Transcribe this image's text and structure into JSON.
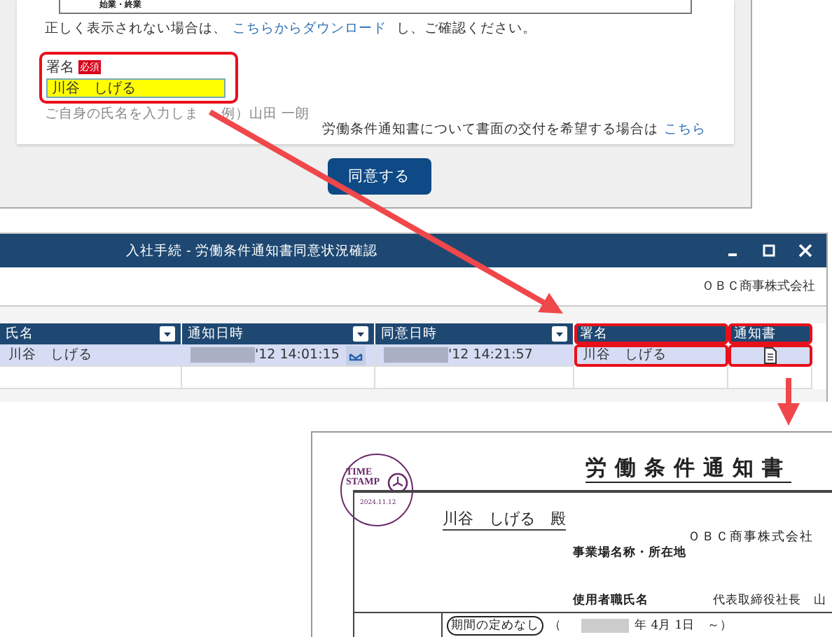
{
  "form_panel": {
    "table_fragment": "始業・終業",
    "download_note": {
      "before": "正しく表示されない場合は、",
      "link": "こちらからダウンロード",
      "after": " し、ご確認ください。"
    },
    "signature": {
      "label": "署名",
      "required_badge": "必須",
      "value": "川谷　しげる",
      "highlighted": true,
      "hint_parts": [
        "ご自身の氏名を入力しま",
        "例）山田 一朗"
      ]
    },
    "paper_request": {
      "text": "労働条件通知書について書面の交付を希望する場合は",
      "link": "こちら"
    },
    "agree_button": "同意する"
  },
  "status_window": {
    "title": "入社手続 - 労働条件通知書同意状況確認",
    "company": "ＯＢＣ商事株式会社",
    "columns": [
      {
        "label": "氏名",
        "filter": true,
        "highlighted": false
      },
      {
        "label": "通知日時",
        "filter": true,
        "highlighted": false
      },
      {
        "label": "同意日時",
        "filter": true,
        "highlighted": false
      },
      {
        "label": "署名",
        "filter": false,
        "highlighted": true
      },
      {
        "label": "通知書",
        "filter": false,
        "highlighted": true
      }
    ],
    "rows": [
      {
        "selected": true,
        "cells": [
          {
            "kind": "text",
            "text": "川谷　しげる"
          },
          {
            "kind": "masked_date",
            "text": "'12 14:01:15",
            "mail_icon": true
          },
          {
            "kind": "masked_date",
            "text": "'12 14:21:57",
            "mail_icon": false
          },
          {
            "kind": "text",
            "text": "川谷　しげる"
          },
          {
            "kind": "document"
          }
        ]
      }
    ]
  },
  "notice_document": {
    "title": "労働条件通知書",
    "stamp": {
      "line1": "TIME",
      "line2": "STAMP",
      "date": "2024.11.12"
    },
    "recipient": "川谷　しげる　殿",
    "company": "ＯＢＣ商事株式会社",
    "office_label": "事業場名称・所在地",
    "employer_label": "使用者職氏名",
    "employer_value": "代表取締役社長　山",
    "period": {
      "label": "期間の定めなし",
      "open": "（",
      "rest": "年 4月 1日　～）"
    }
  }
}
